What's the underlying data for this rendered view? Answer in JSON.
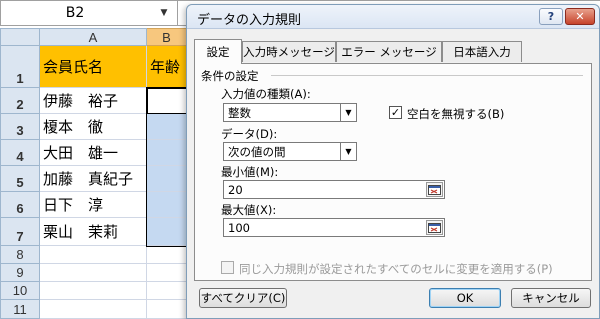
{
  "spreadsheet": {
    "name_box": "B2",
    "name_box_dropdown_icon": "chevron-down-icon",
    "columns": [
      "A",
      "B"
    ],
    "rows": [
      {
        "num": "1",
        "a": "会員氏名",
        "b": "年齢"
      },
      {
        "num": "2",
        "a": "伊藤　裕子",
        "b": ""
      },
      {
        "num": "3",
        "a": "榎本　徹",
        "b": ""
      },
      {
        "num": "4",
        "a": "大田　雄一",
        "b": ""
      },
      {
        "num": "5",
        "a": "加藤　真紀子",
        "b": ""
      },
      {
        "num": "6",
        "a": "日下　淳",
        "b": ""
      },
      {
        "num": "7",
        "a": "栗山　茉莉",
        "b": ""
      },
      {
        "num": "8",
        "a": "",
        "b": ""
      },
      {
        "num": "9",
        "a": "",
        "b": ""
      },
      {
        "num": "10",
        "a": "",
        "b": ""
      },
      {
        "num": "11",
        "a": "",
        "b": ""
      }
    ],
    "colors": {
      "header_fill": "#ffc000",
      "selection_fill": "#c5d9f1",
      "header_bg": "#dbe5f1"
    }
  },
  "dialog": {
    "title": "データの入力規則",
    "help_label": "?",
    "close_label": "✕",
    "tabs": [
      {
        "label": "設定",
        "active": true
      },
      {
        "label": "入力時メッセージ",
        "active": false
      },
      {
        "label": "エラー メッセージ",
        "active": false
      },
      {
        "label": "日本語入力",
        "active": false
      }
    ],
    "settings": {
      "section_title": "条件の設定",
      "allow_label": "入力値の種類(A):",
      "allow_value": "整数",
      "ignore_blank_label": "空白を無視する(B)",
      "ignore_blank_checked": true,
      "ignore_blank_mark": "✓",
      "data_label": "データ(D):",
      "data_value": "次の値の間",
      "min_label": "最小値(M):",
      "min_value": "20",
      "max_label": "最大値(X):",
      "max_value": "100",
      "apply_all_label": "同じ入力規則が設定されたすべてのセルに変更を適用する(P)",
      "apply_all_checked": false
    },
    "buttons": {
      "clear_all": "すべてクリア(C)",
      "ok": "OK",
      "cancel": "キャンセル"
    }
  }
}
